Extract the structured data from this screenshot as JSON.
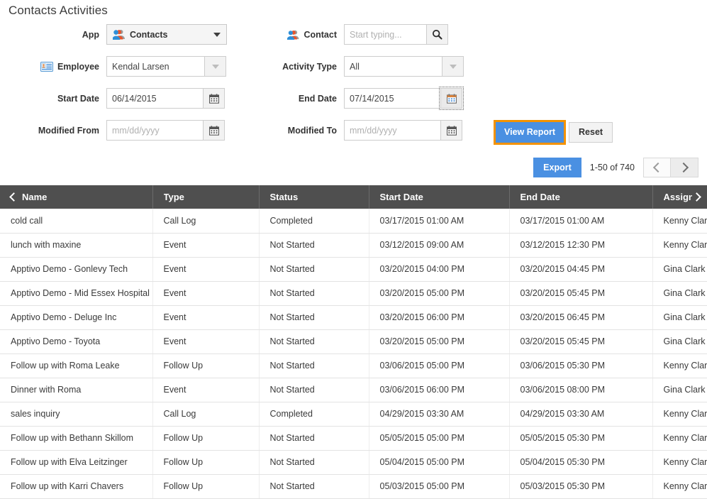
{
  "page": {
    "title": "Contacts Activities"
  },
  "form": {
    "app": {
      "label": "App",
      "icon": "contacts-icon",
      "value": "Contacts"
    },
    "contact": {
      "label": "Contact",
      "icon": "contacts-icon",
      "value": "",
      "placeholder": "Start typing...",
      "search_icon": "search-icon"
    },
    "employee": {
      "label": "Employee",
      "icon": "employee-badge-icon",
      "value": "Kendal Larsen"
    },
    "activity_type": {
      "label": "Activity Type",
      "value": "All"
    },
    "start_date": {
      "label": "Start Date",
      "value": "06/14/2015",
      "placeholder": "mm/dd/yyyy",
      "icon": "calendar-icon"
    },
    "end_date": {
      "label": "End Date",
      "value": "07/14/2015",
      "placeholder": "mm/dd/yyyy",
      "icon": "calendar-icon"
    },
    "modified_from": {
      "label": "Modified From",
      "value": "",
      "placeholder": "mm/dd/yyyy",
      "icon": "calendar-icon"
    },
    "modified_to": {
      "label": "Modified To",
      "value": "",
      "placeholder": "mm/dd/yyyy",
      "icon": "calendar-icon"
    },
    "view_report_label": "View Report",
    "reset_label": "Reset"
  },
  "toolbar": {
    "export_label": "Export",
    "range_text": "1-50 of 740",
    "prev_icon": "chevron-left-icon",
    "next_icon": "chevron-right-icon"
  },
  "grid": {
    "columns": [
      {
        "key": "name",
        "label": "Name"
      },
      {
        "key": "type",
        "label": "Type"
      },
      {
        "key": "status",
        "label": "Status"
      },
      {
        "key": "start",
        "label": "Start Date"
      },
      {
        "key": "end",
        "label": "End Date"
      },
      {
        "key": "assign",
        "label": "Assigned"
      }
    ],
    "rows": [
      {
        "name": "cold call",
        "type": "Call Log",
        "status": "Completed",
        "start": "03/17/2015 01:00 AM",
        "end": "03/17/2015 01:00 AM",
        "assign": "Kenny Clark"
      },
      {
        "name": "lunch with maxine",
        "type": "Event",
        "status": "Not Started",
        "start": "03/12/2015 09:00 AM",
        "end": "03/12/2015 12:30 PM",
        "assign": "Kenny Clark"
      },
      {
        "name": "Apptivo Demo - Gonlevy Tech",
        "type": "Event",
        "status": "Not Started",
        "start": "03/20/2015 04:00 PM",
        "end": "03/20/2015 04:45 PM",
        "assign": "Gina Clark"
      },
      {
        "name": "Apptivo Demo - Mid Essex Hospital",
        "type": "Event",
        "status": "Not Started",
        "start": "03/20/2015 05:00 PM",
        "end": "03/20/2015 05:45 PM",
        "assign": "Gina Clark"
      },
      {
        "name": "Apptivo Demo - Deluge Inc",
        "type": "Event",
        "status": "Not Started",
        "start": "03/20/2015 06:00 PM",
        "end": "03/20/2015 06:45 PM",
        "assign": "Gina Clark"
      },
      {
        "name": "Apptivo Demo - Toyota",
        "type": "Event",
        "status": "Not Started",
        "start": "03/20/2015 05:00 PM",
        "end": "03/20/2015 05:45 PM",
        "assign": "Gina Clark"
      },
      {
        "name": "Follow up with Roma Leake",
        "type": "Follow Up",
        "status": "Not Started",
        "start": "03/06/2015 05:00 PM",
        "end": "03/06/2015 05:30 PM",
        "assign": "Kenny Clark"
      },
      {
        "name": "Dinner with Roma",
        "type": "Event",
        "status": "Not Started",
        "start": "03/06/2015 06:00 PM",
        "end": "03/06/2015 08:00 PM",
        "assign": "Gina Clark"
      },
      {
        "name": "sales inquiry",
        "type": "Call Log",
        "status": "Completed",
        "start": "04/29/2015 03:30 AM",
        "end": "04/29/2015 03:30 AM",
        "assign": "Kenny Clark"
      },
      {
        "name": "Follow up with Bethann Skillom",
        "type": "Follow Up",
        "status": "Not Started",
        "start": "05/05/2015 05:00 PM",
        "end": "05/05/2015 05:30 PM",
        "assign": "Kenny Clark"
      },
      {
        "name": "Follow up with Elva Leitzinger",
        "type": "Follow Up",
        "status": "Not Started",
        "start": "05/04/2015 05:00 PM",
        "end": "05/04/2015 05:30 PM",
        "assign": "Kenny Clark"
      },
      {
        "name": "Follow up with Karri Chavers",
        "type": "Follow Up",
        "status": "Not Started",
        "start": "05/03/2015 05:00 PM",
        "end": "05/03/2015 05:30 PM",
        "assign": "Kenny Clark"
      }
    ]
  },
  "colors": {
    "primary": "#4a90e2",
    "focus_ring": "#f39200",
    "header_bg": "#4f4f4f"
  }
}
